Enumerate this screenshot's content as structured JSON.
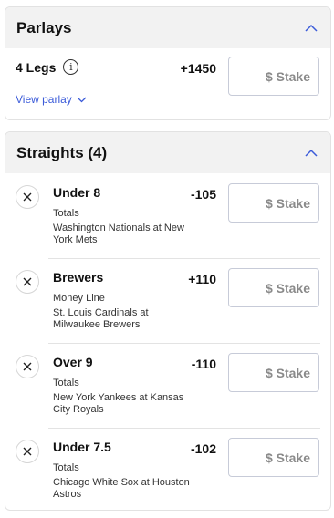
{
  "parlays": {
    "title": "Parlays",
    "legs_label": "4 Legs",
    "info_glyph": "i",
    "odds": "+1450",
    "stake_placeholder": "$ Stake",
    "view_label": "View parlay",
    "collapse_icon": "chevron-up-icon"
  },
  "straights": {
    "title": "Straights (4)",
    "collapse_icon": "chevron-up-icon",
    "bets": [
      {
        "selection": "Under 8",
        "odds": "-105",
        "market": "Totals",
        "matchup": "Washington Nationals at New York Mets",
        "stake_placeholder": "$ Stake"
      },
      {
        "selection": "Brewers",
        "odds": "+110",
        "market": "Money Line",
        "matchup": "St. Louis Cardinals at Milwaukee Brewers",
        "stake_placeholder": "$ Stake"
      },
      {
        "selection": "Over 9",
        "odds": "-110",
        "market": "Totals",
        "matchup": "New York Yankees at Kansas City Royals",
        "stake_placeholder": "$ Stake"
      },
      {
        "selection": "Under 7.5",
        "odds": "-102",
        "market": "Totals",
        "matchup": "Chicago White Sox at Houston Astros",
        "stake_placeholder": "$ Stake"
      }
    ]
  },
  "colors": {
    "accent": "#3b5bd9",
    "header_bg": "#f2f2f2",
    "border": "#e2e2e2",
    "stake_border": "#c7cbd8"
  }
}
